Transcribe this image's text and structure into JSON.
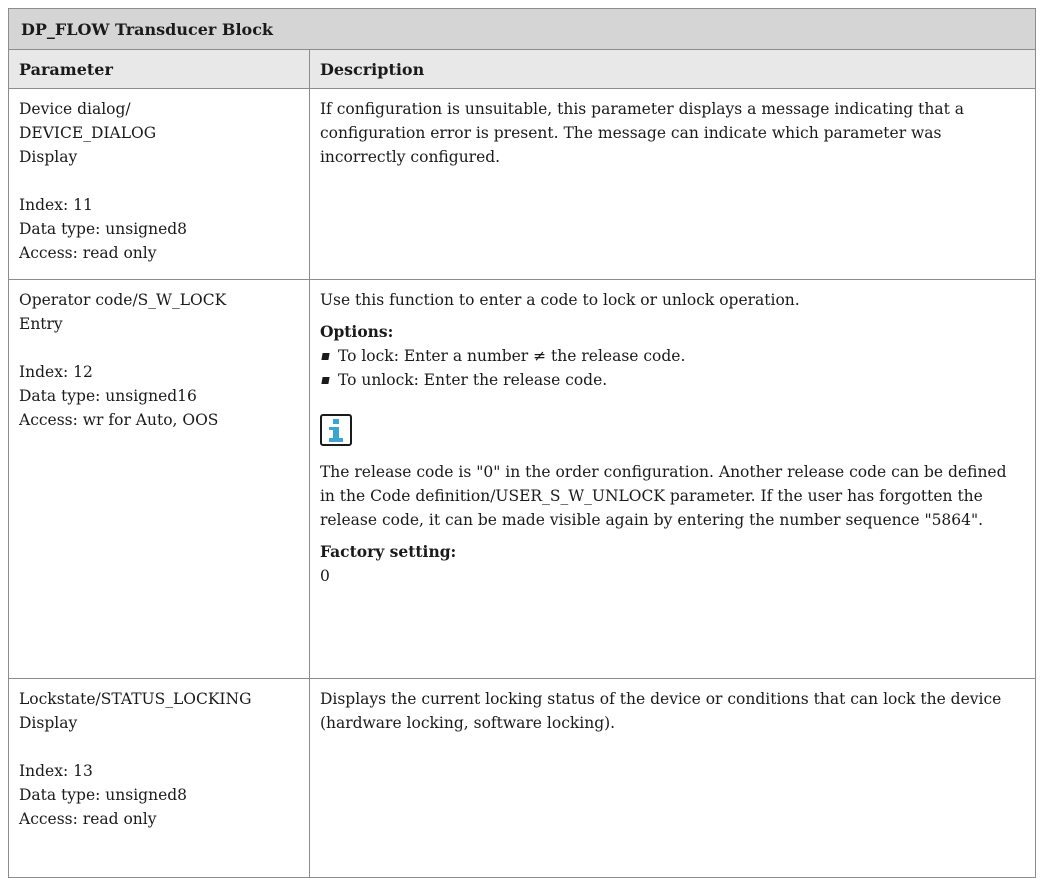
{
  "title": "DP_FLOW Transducer Block",
  "headers": {
    "parameter": "Parameter",
    "description": "Description"
  },
  "rows": [
    {
      "param_lines": [
        "Device dialog/",
        "DEVICE_DIALOG",
        "Display"
      ],
      "param_meta": [
        "Index: 11",
        "Data type: unsigned8",
        "Access: read only"
      ],
      "description": "If configuration is unsuitable, this parameter displays a message indicating that a configuration error is present. The message can indicate which parameter was incorrectly configured."
    },
    {
      "param_lines": [
        "Operator code/S_W_LOCK",
        "Entry"
      ],
      "param_meta": [
        "Index: 12",
        "Data type: unsigned16",
        "Access: wr for Auto, OOS"
      ],
      "description": "Use this function to enter a code to lock or unlock operation.",
      "options_title": "Options:",
      "options": [
        "To lock: Enter a number ≠ the release code.",
        "To unlock: Enter the release code."
      ],
      "info_icon": "info-icon",
      "note": "The release code is \"0\" in the order configuration. Another release code can be defined in the Code definition/USER_S_W_UNLOCK parameter. If the user has forgotten the release code, it can be made visible again by entering the number sequence \"5864\".",
      "factory_title": "Factory setting:",
      "factory_value": "0"
    },
    {
      "param_lines": [
        "Lockstate/STATUS_LOCKING",
        "Display"
      ],
      "param_meta": [
        "Index: 13",
        "Data type: unsigned8",
        "Access: read only"
      ],
      "description": "Displays the current locking status of the device or conditions that can lock the device (hardware locking, software locking)."
    }
  ]
}
